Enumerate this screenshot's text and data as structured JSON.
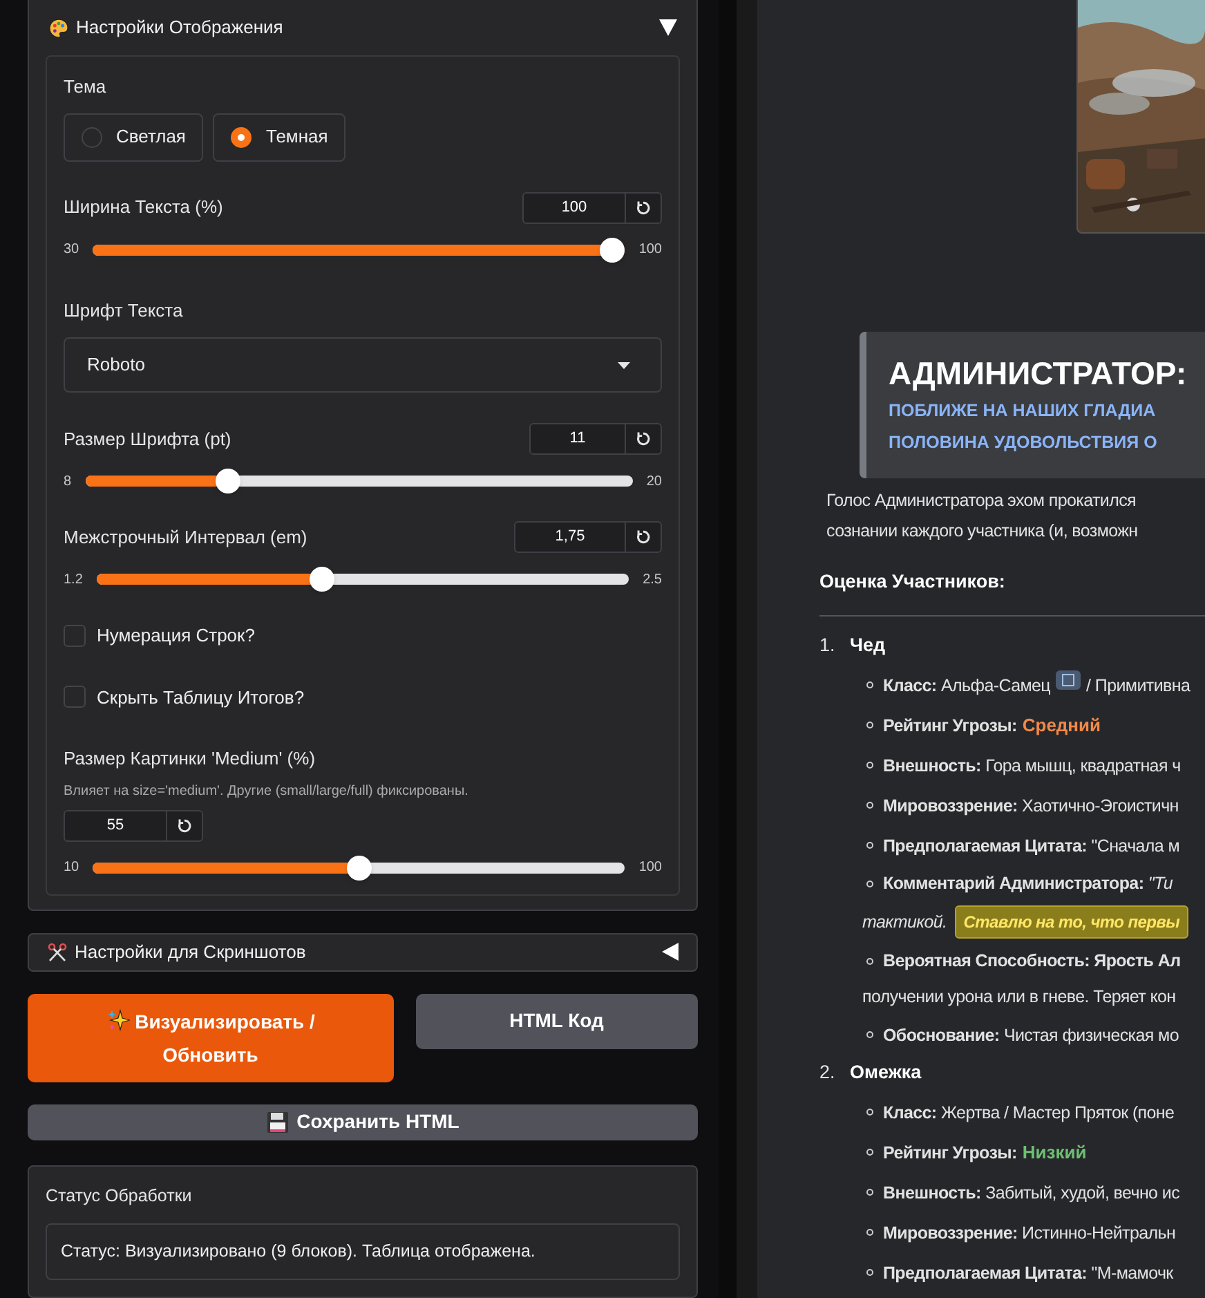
{
  "display_settings": {
    "title": "Настройки Отображения",
    "expanded": true,
    "theme": {
      "label": "Тема",
      "options": [
        {
          "label": "Светлая",
          "selected": false
        },
        {
          "label": "Темная",
          "selected": true
        }
      ]
    },
    "text_width": {
      "label": "Ширина Текста (%)",
      "value": "100",
      "min": "30",
      "max": "100",
      "level": 1.0
    },
    "font": {
      "label": "Шрифт Текста",
      "value": "Roboto"
    },
    "font_size": {
      "label": "Размер Шрифта (pt)",
      "value": "11",
      "min": "8",
      "max": "20",
      "level": 0.25
    },
    "line_spacing": {
      "label": "Межстрочный Интервал (em)",
      "value": "1,75",
      "min": "1.2",
      "max": "2.5",
      "level": 0.42
    },
    "checkboxes": [
      {
        "label": "Нумерация Строк?",
        "checked": false
      },
      {
        "label": "Скрыть Таблицу Итогов?",
        "checked": false
      }
    ],
    "image_size": {
      "label": "Размер Картинки 'Medium' (%)",
      "description": "Влияет на size='medium'. Другие (small/large/full) фиксированы.",
      "value": "55",
      "min": "10",
      "max": "100",
      "level": 0.5
    }
  },
  "screenshot_settings": {
    "title": "Настройки для Скриншотов",
    "expanded": false
  },
  "buttons": [
    {
      "label": "Визуализировать / Обновить",
      "kind": "primary"
    },
    {
      "label": "HTML Код",
      "kind": "secondary"
    }
  ],
  "save_button": {
    "label": "Сохранить HTML"
  },
  "status": {
    "label": "Статус Обработки",
    "value": "Статус: Визуализировано (9 блоков). Таблица отображена."
  },
  "preview": {
    "callout": {
      "title": "АДМИНИСТРАТОР:",
      "lines": [
        "ПОБЛИЖЕ НА НАШИХ ГЛАДИА",
        "ПОЛОВИНА УДОВОЛЬСТВИЯ О"
      ]
    },
    "intro": [
      "Голос Администратора эхом прокатился",
      "сознании каждого участника (и, возможн"
    ],
    "section_title": "Оценка Участников:",
    "participants": [
      {
        "number": "1.",
        "name": "Чед",
        "items": [
          {
            "kind": "plain",
            "text": "**Класс:** Альфа-Самец",
            "badge": true,
            "after": "/ Примитивна"
          },
          {
            "kind": "threat",
            "text": "**Рейтинг Угрозы:**",
            "value": "Средний",
            "color": "#f0894a"
          },
          {
            "kind": "plain",
            "text": "**Внешность:** Гора мышц, квадратная ч"
          },
          {
            "kind": "plain",
            "text": "**Мировоззрение:** Хаотично-Эгоистичн"
          },
          {
            "kind": "plain",
            "text": "**Предполагаемая Цитата:** \"Сначала м"
          },
          {
            "kind": "wrapped",
            "text": "**Комментарий Администратора:** *\"Ти*",
            "continuation": "*тактикой.*",
            "highlight": "Ставлю на то, что первы"
          },
          {
            "kind": "wrapped",
            "text": "**Вероятная Способность: Ярость Ал**",
            "continuation": "получении урона или в гневе. Теряет кон"
          },
          {
            "kind": "plain",
            "text": "**Обоснование:** Чистая физическая мо"
          }
        ]
      },
      {
        "number": "2.",
        "name": "Омежка",
        "items": [
          {
            "kind": "plain",
            "text": "**Класс:** Жертва / Мастер Пряток (поне"
          },
          {
            "kind": "threat",
            "text": "**Рейтинг Угрозы:**",
            "value": "Низкий",
            "color": "#6fbf73"
          },
          {
            "kind": "plain",
            "text": "**Внешность:** Забитый, худой, вечно ис"
          },
          {
            "kind": "plain",
            "text": "**Мировоззрение:** Истинно-Нейтральн"
          },
          {
            "kind": "plain",
            "text": "**Предполагаемая Цитата:** \"М-мамочк"
          }
        ]
      }
    ]
  }
}
